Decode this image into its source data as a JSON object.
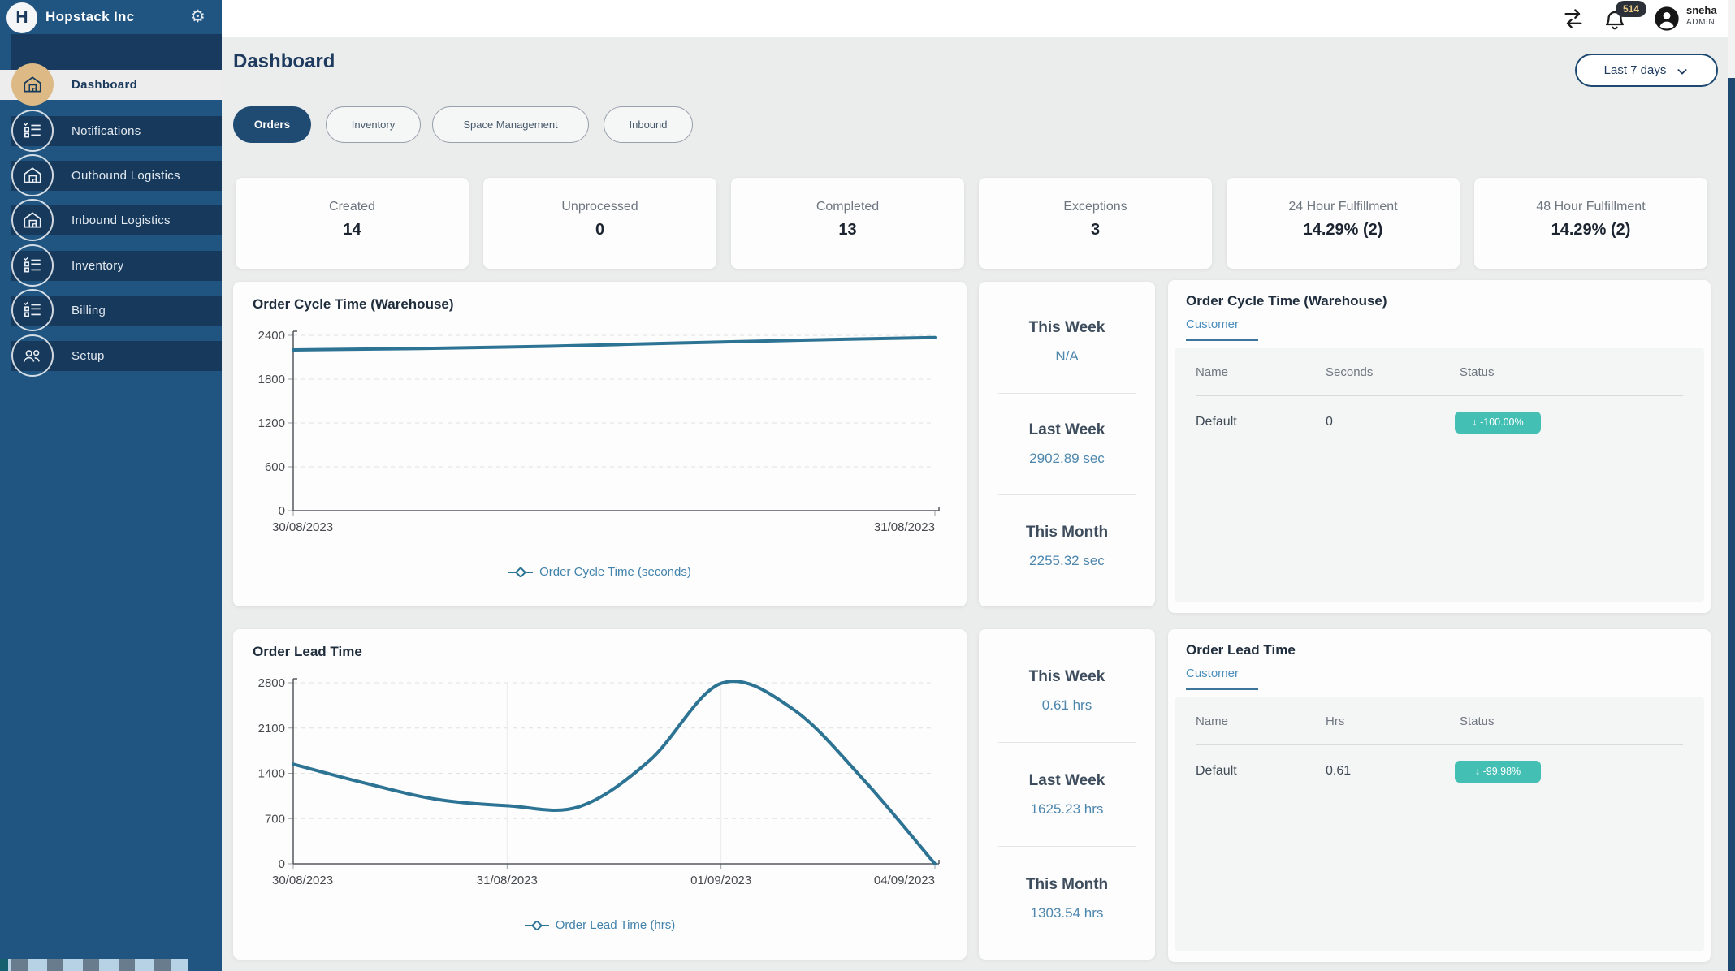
{
  "sidebar": {
    "brand": "Hopstack Inc",
    "items": [
      {
        "label": "Dashboard",
        "icon": "warehouse-icon",
        "active": true
      },
      {
        "label": "Notifications",
        "icon": "checklist-icon",
        "active": false
      },
      {
        "label": "Outbound Logistics",
        "icon": "warehouse-icon",
        "active": false
      },
      {
        "label": "Inbound Logistics",
        "icon": "warehouse-icon",
        "active": false
      },
      {
        "label": "Inventory",
        "icon": "checklist-icon",
        "active": false
      },
      {
        "label": "Billing",
        "icon": "checklist-icon",
        "active": false
      },
      {
        "label": "Setup",
        "icon": "users-icon",
        "active": false
      }
    ]
  },
  "topbar": {
    "notification_count": "514",
    "user_name": "sneha",
    "user_role": "ADMIN"
  },
  "page": {
    "title": "Dashboard",
    "date_filter": "Last 7 days"
  },
  "tabs": [
    {
      "label": "Orders",
      "active": true
    },
    {
      "label": "Inventory",
      "active": false
    },
    {
      "label": "Space Management",
      "active": false
    },
    {
      "label": "Inbound",
      "active": false
    }
  ],
  "stats": [
    {
      "label": "Created",
      "value": "14"
    },
    {
      "label": "Unprocessed",
      "value": "0"
    },
    {
      "label": "Completed",
      "value": "13"
    },
    {
      "label": "Exceptions",
      "value": "3"
    },
    {
      "label": "24 Hour Fulfillment",
      "value": "14.29% (2)"
    },
    {
      "label": "48 Hour Fulfillment",
      "value": "14.29% (2)"
    }
  ],
  "panels": {
    "cycle": {
      "summary": [
        {
          "label": "This Week",
          "value": "N/A"
        },
        {
          "label": "Last Week",
          "value": "2902.89 sec"
        },
        {
          "label": "This Month",
          "value": "2255.32 sec"
        }
      ],
      "table": {
        "title": "Order Cycle Time (Warehouse)",
        "tab": "Customer",
        "columns": [
          "Name",
          "Seconds",
          "Status"
        ],
        "rows": [
          {
            "name": "Default",
            "value": "0",
            "status": "↓ -100.00%"
          }
        ]
      }
    },
    "lead": {
      "summary": [
        {
          "label": "This Week",
          "value": "0.61 hrs"
        },
        {
          "label": "Last Week",
          "value": "1625.23 hrs"
        },
        {
          "label": "This Month",
          "value": "1303.54 hrs"
        }
      ],
      "table": {
        "title": "Order Lead Time",
        "tab": "Customer",
        "columns": [
          "Name",
          "Hrs",
          "Status"
        ],
        "rows": [
          {
            "name": "Default",
            "value": "0.61",
            "status": "↓ -99.98%"
          }
        ]
      }
    }
  },
  "chart_data": [
    {
      "type": "line",
      "title": "Order Cycle Time (Warehouse)",
      "x": [
        "30/08/2023",
        "31/08/2023"
      ],
      "values": [
        2200,
        2370
      ],
      "curve_samples": [
        2200,
        2220,
        2250,
        2295,
        2335,
        2370
      ],
      "ylim": [
        0,
        2400
      ],
      "yticks": [
        0,
        600,
        1200,
        1800,
        2400
      ],
      "legend": "Order Cycle Time (seconds)",
      "line_color": "#2c7394",
      "grid": "horizontal-dashed, vertical at interior ticks",
      "legend_position": "bottom"
    },
    {
      "type": "line",
      "title": "Order Lead Time",
      "x": [
        "30/08/2023",
        "31/08/2023",
        "01/09/2023",
        "04/09/2023"
      ],
      "values": [
        1540,
        900,
        2790,
        0
      ],
      "curve_samples": [
        1540,
        1250,
        1000,
        900,
        880,
        1600,
        2790,
        2400,
        1300,
        0
      ],
      "ylim": [
        0,
        2800
      ],
      "yticks": [
        0,
        700,
        1400,
        2100,
        2800
      ],
      "legend": "Order Lead Time (hrs)",
      "line_color": "#2c7394",
      "grid": "horizontal-dashed, vertical at interior ticks",
      "legend_position": "bottom"
    }
  ],
  "colors": {
    "sidebar_backdrop": "#215581",
    "sidebar_row": "#17395c",
    "accent_navy": "#1f4b72",
    "active_icon_tan": "#ddba85",
    "value_blue": "#4e87ae",
    "badge_teal": "#43bfb4",
    "chart_line": "#2c7394"
  }
}
